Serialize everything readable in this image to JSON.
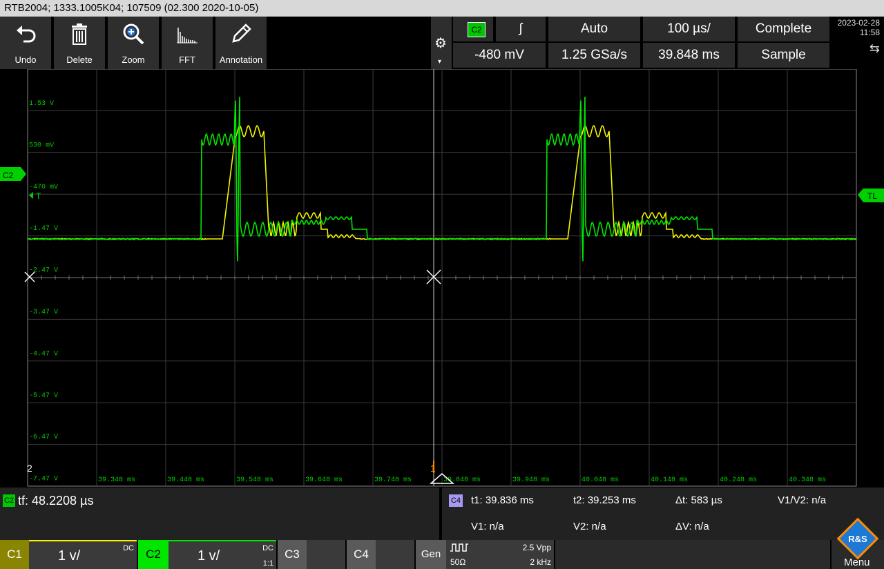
{
  "title_bar": "RTB2004; 1333.1005K04; 107509 (02.300 2020-10-05)",
  "toolbar": {
    "undo": "Undo",
    "delete": "Delete",
    "zoom": "Zoom",
    "fft": "FFT",
    "annotation": "Annotation"
  },
  "trigger": {
    "source": "C2",
    "slope_symbol": "ʃ",
    "mode": "Auto",
    "timebase": "100 µs/",
    "acq_state": "Complete",
    "level": "-480 mV",
    "sample_rate": "1.25 GSa/s",
    "position": "39.848 ms",
    "acq_mode": "Sample"
  },
  "datetime": {
    "date": "2023-02-28",
    "time": "11:58"
  },
  "plot": {
    "left_marker": "C2",
    "trigger_level_marker": "TL",
    "ch2_ground_marker": "2",
    "trigger_pos_marker": "1",
    "y_labels": [
      "1.53 V",
      "530 mV",
      "-470 mV",
      "-1.47 V",
      "-2.47 V",
      "-3.47 V",
      "-4.47 V",
      "-5.47 V",
      "-6.47 V",
      "-7.47 V"
    ],
    "x_labels": [
      "39.348 ms",
      "39.448 ms",
      "39.548 ms",
      "39.648 ms",
      "39.748 ms",
      "39.848 ms",
      "39.948 ms",
      "40.048 ms",
      "40.148 ms",
      "40.248 ms",
      "40.348 ms"
    ]
  },
  "measurement": {
    "src_left": "C2",
    "fall_time": "tf: 48.2208 µs",
    "src_right": "C4",
    "t1": "t1: 39.836 ms",
    "t2": "t2: 39.253 ms",
    "dt": "Δt: 583 µs",
    "v1v2": "V1/V2: n/a",
    "v1": "V1: n/a",
    "v2": "V2: n/a",
    "dv": "ΔV: n/a"
  },
  "channels": {
    "c1": {
      "label": "C1",
      "scale": "1 v/",
      "coupling": "DC",
      "probe": ""
    },
    "c2": {
      "label": "C2",
      "scale": "1 v/",
      "coupling": "DC",
      "probe": "1:1"
    },
    "c3": {
      "label": "C3"
    },
    "c4": {
      "label": "C4"
    },
    "gen": {
      "label": "Gen",
      "amplitude": "2.5 Vpp",
      "impedance": "50Ω",
      "frequency": "2 kHz"
    },
    "menu": "Menu",
    "logo": "R&S"
  },
  "colors": {
    "ch1": "#f5f500",
    "ch2": "#00e600",
    "grid": "#3c3c3c",
    "accent": "#00d000"
  }
}
